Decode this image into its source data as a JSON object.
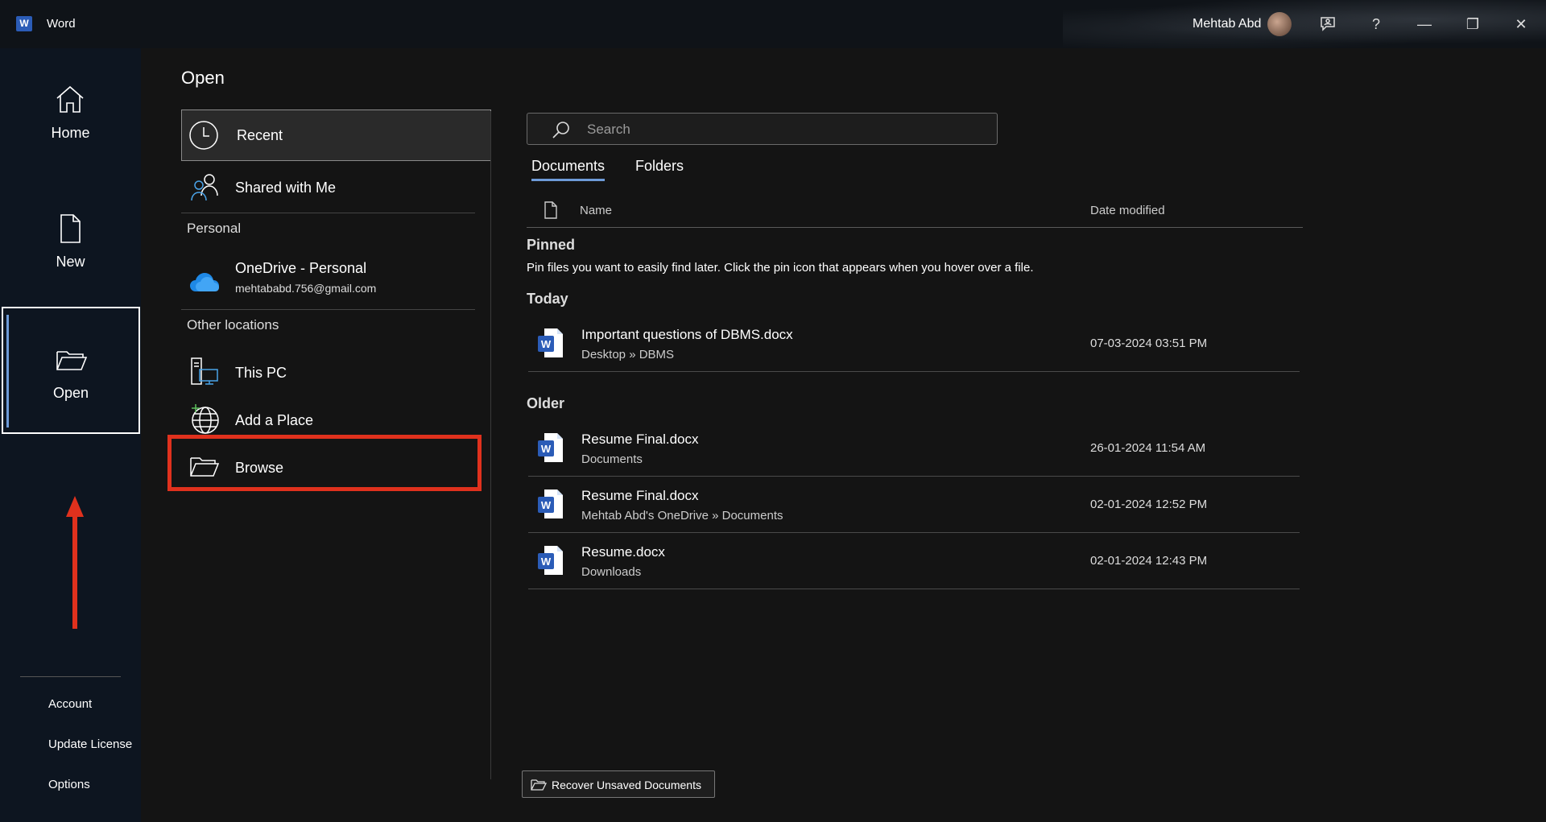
{
  "titlebar": {
    "app_name": "Word",
    "user_name": "Mehtab Abd",
    "help_glyph": "?",
    "minimize_glyph": "—",
    "restore_glyph": "❐",
    "close_glyph": "✕"
  },
  "nav": {
    "home": "Home",
    "new": "New",
    "open": "Open",
    "account": "Account",
    "update_license": "Update License",
    "options": "Options"
  },
  "page_title": "Open",
  "locations": {
    "recent": "Recent",
    "shared": "Shared with Me",
    "personal_header": "Personal",
    "onedrive": "OneDrive - Personal",
    "onedrive_email": "mehtababd.756@gmail.com",
    "other_header": "Other locations",
    "this_pc": "This PC",
    "add_place": "Add a Place",
    "browse": "Browse"
  },
  "search": {
    "placeholder": "Search"
  },
  "tabs": {
    "documents": "Documents",
    "folders": "Folders"
  },
  "columns": {
    "name": "Name",
    "date": "Date modified"
  },
  "groups": {
    "pinned": "Pinned",
    "pinned_desc": "Pin files you want to easily find later. Click the pin icon that appears when you hover over a file.",
    "today": "Today",
    "older": "Older"
  },
  "files": [
    {
      "name": "Important questions of DBMS.docx",
      "path": "Desktop » DBMS",
      "date": "07-03-2024 03:51 PM"
    },
    {
      "name": "Resume Final.docx",
      "path": "Documents",
      "date": "26-01-2024 11:54 AM"
    },
    {
      "name": "Resume Final.docx",
      "path": "Mehtab Abd's OneDrive » Documents",
      "date": "02-01-2024 12:52 PM"
    },
    {
      "name": "Resume.docx",
      "path": "Downloads",
      "date": "02-01-2024 12:43 PM"
    }
  ],
  "recover_button": "Recover Unsaved Documents",
  "icons": {
    "app": "word-icon",
    "home": "home-icon",
    "new": "new-document-icon",
    "open": "folder-open-icon",
    "recent": "clock-icon",
    "shared": "people-icon",
    "onedrive": "cloud-icon",
    "this_pc": "computer-icon",
    "add_place": "globe-icon",
    "browse": "folder-open-icon",
    "search": "search-icon",
    "file": "word-document-icon"
  },
  "colors": {
    "accent": "#6e9bd8",
    "annotation": "#e0311d",
    "word_blue": "#2b5cb7",
    "onedrive_blue": "#1e88e5"
  }
}
